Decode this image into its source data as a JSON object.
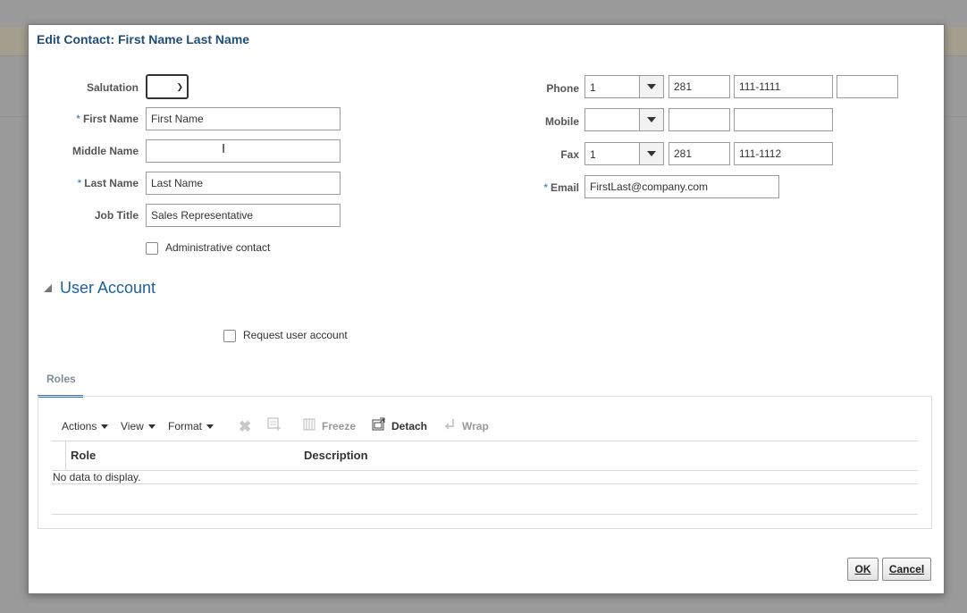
{
  "dialog": {
    "title": "Edit Contact: First Name Last Name"
  },
  "form": {
    "salutation_label": "Salutation",
    "salutation_value": "",
    "first_name_label": "First Name",
    "first_name_value": "First Name",
    "middle_name_label": "Middle Name",
    "middle_name_value": "",
    "last_name_label": "Last Name",
    "last_name_value": "Last Name",
    "job_title_label": "Job Title",
    "job_title_value": "Sales Representative",
    "admin_contact_label": "Administrative contact",
    "admin_contact_checked": false,
    "required_mark": "*"
  },
  "contact": {
    "phone_label": "Phone",
    "phone_country": "1",
    "phone_area": "281",
    "phone_number": "111-1111",
    "phone_ext": "",
    "mobile_label": "Mobile",
    "mobile_country": "",
    "mobile_area": "",
    "mobile_number": "",
    "fax_label": "Fax",
    "fax_country": "1",
    "fax_area": "281",
    "fax_number": "111-1112",
    "email_label": "Email",
    "email_value": "FirstLast@company.com"
  },
  "user_account": {
    "section_title": "User Account",
    "request_label": "Request user account",
    "request_checked": false
  },
  "roles": {
    "tab_label": "Roles",
    "toolbar": {
      "actions": "Actions",
      "view": "View",
      "format": "Format",
      "freeze": "Freeze",
      "detach": "Detach",
      "wrap": "Wrap"
    },
    "columns": [
      "Role",
      "Description"
    ],
    "empty_text": "No data to display."
  },
  "buttons": {
    "ok": "OK",
    "cancel": "Cancel"
  }
}
